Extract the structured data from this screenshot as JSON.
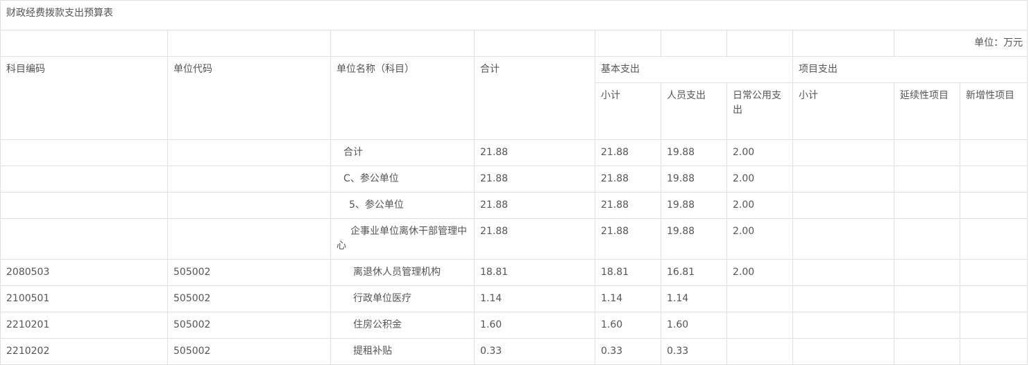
{
  "title": "财政经费拨款支出预算表",
  "unit": "单位：万元",
  "headers": {
    "code": "科目编码",
    "unit_code": "单位代码",
    "name": "单位名称（科目）",
    "total": "合计",
    "basic": "基本支出",
    "project": "项目支出",
    "basic_subtotal": "小计",
    "personnel": "人员支出",
    "public": "日常公用支出",
    "project_subtotal": "小计",
    "continuing": "延续性项目",
    "new": "新增性项目"
  },
  "rows": [
    {
      "code": "",
      "unit_code": "",
      "name": "合计",
      "total": "21.88",
      "basic_subtotal": "21.88",
      "personnel": "19.88",
      "public": "2.00",
      "project_subtotal": "",
      "continuing": "",
      "new": ""
    },
    {
      "code": "",
      "unit_code": "",
      "name": "C、参公单位",
      "total": "21.88",
      "basic_subtotal": "21.88",
      "personnel": "19.88",
      "public": "2.00",
      "project_subtotal": "",
      "continuing": "",
      "new": ""
    },
    {
      "code": "",
      "unit_code": "",
      "name": "5、参公单位",
      "total": "21.88",
      "basic_subtotal": "21.88",
      "personnel": "19.88",
      "public": "2.00",
      "project_subtotal": "",
      "continuing": "",
      "new": ""
    },
    {
      "code": "",
      "unit_code": "",
      "name": "企事业单位离休干部管理中心",
      "total": "21.88",
      "basic_subtotal": "21.88",
      "personnel": "19.88",
      "public": "2.00",
      "project_subtotal": "",
      "continuing": "",
      "new": ""
    },
    {
      "code": "2080503",
      "unit_code": "505002",
      "name": "离退休人员管理机构",
      "total": "18.81",
      "basic_subtotal": "18.81",
      "personnel": "16.81",
      "public": "2.00",
      "project_subtotal": "",
      "continuing": "",
      "new": ""
    },
    {
      "code": "2100501",
      "unit_code": "505002",
      "name": "行政单位医疗",
      "total": "1.14",
      "basic_subtotal": "1.14",
      "personnel": "1.14",
      "public": "",
      "project_subtotal": "",
      "continuing": "",
      "new": ""
    },
    {
      "code": "2210201",
      "unit_code": "505002",
      "name": "住房公积金",
      "total": "1.60",
      "basic_subtotal": "1.60",
      "personnel": "1.60",
      "public": "",
      "project_subtotal": "",
      "continuing": "",
      "new": ""
    },
    {
      "code": "2210202",
      "unit_code": "505002",
      "name": "提租补贴",
      "total": "0.33",
      "basic_subtotal": "0.33",
      "personnel": "0.33",
      "public": "",
      "project_subtotal": "",
      "continuing": "",
      "new": ""
    }
  ]
}
